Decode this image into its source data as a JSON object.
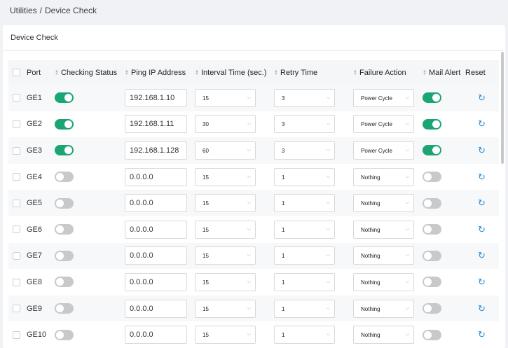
{
  "breadcrumb": {
    "parent": "Utilities",
    "separator": "/",
    "current": "Device Check"
  },
  "card": {
    "title": "Device Check"
  },
  "columns": {
    "port": "Port",
    "checking_status": "Checking Status",
    "ping_ip": "Ping IP Address",
    "interval": "Interval Time (sec.)",
    "retry": "Retry Time",
    "failure_action": "Failure Action",
    "mail_alert": "Mail Alert",
    "reset": "Reset"
  },
  "rows": [
    {
      "port": "GE1",
      "checking": "on",
      "ip": "192.168.1.10",
      "interval": "15",
      "retry": "3",
      "action": "Power Cycle",
      "mail": "on"
    },
    {
      "port": "GE2",
      "checking": "on",
      "ip": "192.168.1.11",
      "interval": "30",
      "retry": "3",
      "action": "Power Cycle",
      "mail": "on"
    },
    {
      "port": "GE3",
      "checking": "on",
      "ip": "192.168.1.128",
      "interval": "60",
      "retry": "3",
      "action": "Power Cycle",
      "mail": "on"
    },
    {
      "port": "GE4",
      "checking": "off",
      "ip": "0.0.0.0",
      "interval": "15",
      "retry": "1",
      "action": "Nothing",
      "mail": "off"
    },
    {
      "port": "GE5",
      "checking": "off",
      "ip": "0.0.0.0",
      "interval": "15",
      "retry": "1",
      "action": "Nothing",
      "mail": "off"
    },
    {
      "port": "GE6",
      "checking": "off",
      "ip": "0.0.0.0",
      "interval": "15",
      "retry": "1",
      "action": "Nothing",
      "mail": "off"
    },
    {
      "port": "GE7",
      "checking": "off",
      "ip": "0.0.0.0",
      "interval": "15",
      "retry": "1",
      "action": "Nothing",
      "mail": "off"
    },
    {
      "port": "GE8",
      "checking": "off",
      "ip": "0.0.0.0",
      "interval": "15",
      "retry": "1",
      "action": "Nothing",
      "mail": "off"
    },
    {
      "port": "GE9",
      "checking": "off",
      "ip": "0.0.0.0",
      "interval": "15",
      "retry": "1",
      "action": "Nothing",
      "mail": "off"
    },
    {
      "port": "GE10",
      "checking": "off",
      "ip": "0.0.0.0",
      "interval": "15",
      "retry": "1",
      "action": "Nothing",
      "mail": "off"
    }
  ],
  "icons": {
    "sort": "sort-arrows-icon",
    "dropdown": "chevron-down-icon",
    "reset": "refresh-icon"
  },
  "colors": {
    "toggle_on": "#1aa572",
    "toggle_off": "#c9c9c9",
    "reset_icon": "#2a8fd6"
  }
}
